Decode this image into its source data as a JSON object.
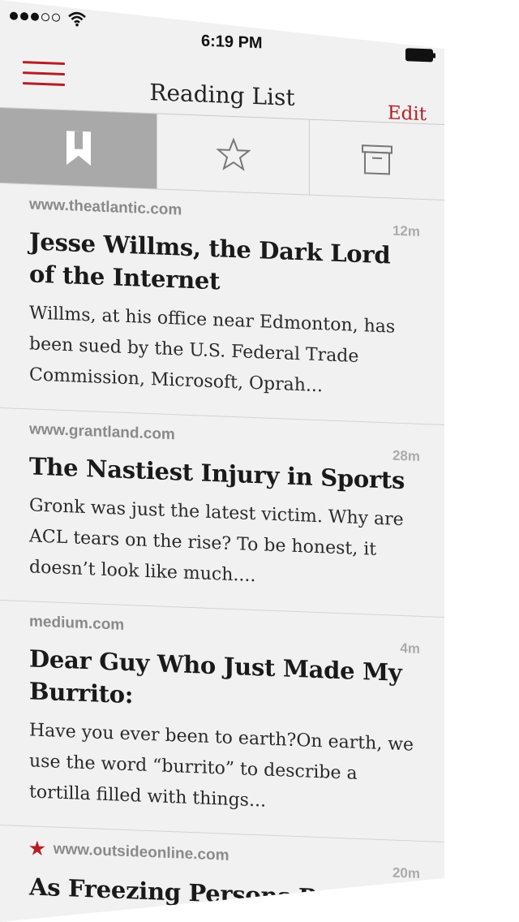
{
  "status_bar": {
    "time": "6:19 PM",
    "signal_filled": 3,
    "signal_total": 5
  },
  "nav": {
    "title": "Reading List",
    "edit_label": "Edit"
  },
  "tabs": [
    {
      "icon": "bookmark-icon",
      "active": true
    },
    {
      "icon": "star-icon",
      "active": false
    },
    {
      "icon": "archive-icon",
      "active": false
    }
  ],
  "colors": {
    "accent": "#b51e24",
    "active_tab": "#a9a9a9",
    "background": "#f1f1f1"
  },
  "articles": [
    {
      "domain": "www.theatlantic.com",
      "age": "12m",
      "title": "Jesse Willms, the Dark Lord of the Internet",
      "excerpt": "Willms, at his office near Edmonton, has been sued by the U.S. Federal Trade Commission, Microsoft, Oprah...",
      "starred": false
    },
    {
      "domain": "www.grantland.com",
      "age": "28m",
      "title": "The Nastiest Injury in Sports",
      "excerpt": "Gronk was just the latest victim. Why are ACL tears on the rise? To be honest, it doesn’t look like much....",
      "starred": false
    },
    {
      "domain": "medium.com",
      "age": "4m",
      "title": "Dear Guy Who Just Made My Burrito:",
      "excerpt": "Have you ever been to earth?On earth, we use the word “burrito” to describe a tortilla filled with things...",
      "starred": false
    },
    {
      "domain": "www.outsideonline.com",
      "age": "20m",
      "title": "As Freezing Persons Recollect",
      "excerpt": "",
      "starred": true
    }
  ]
}
